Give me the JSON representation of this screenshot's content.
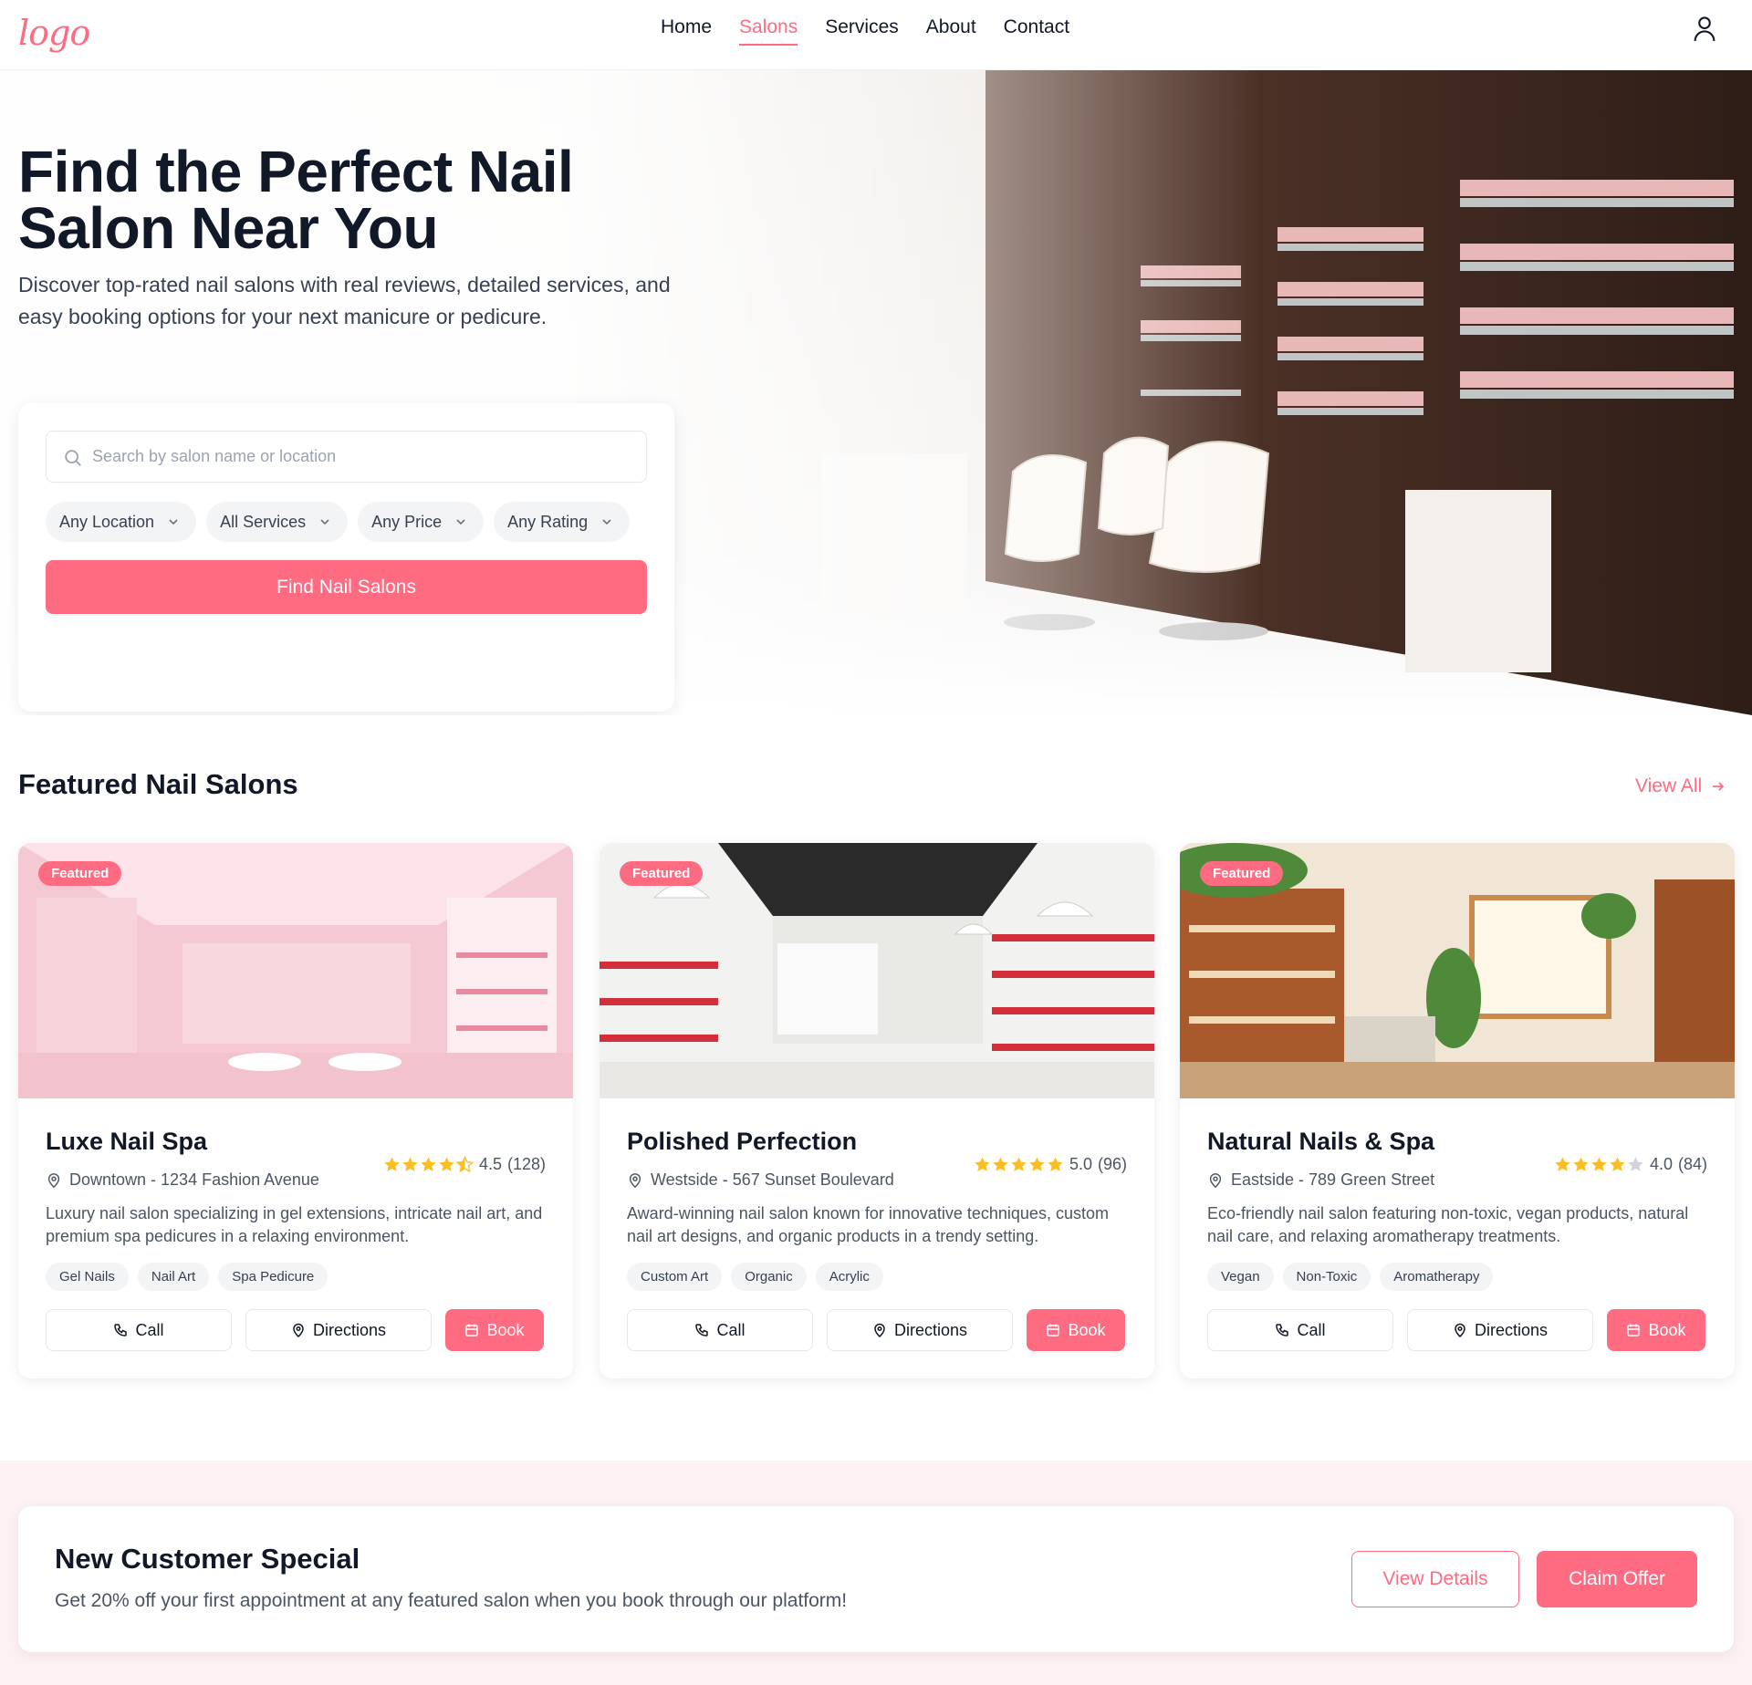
{
  "header": {
    "logo_text": "logo",
    "nav": [
      {
        "label": "Home",
        "active": false
      },
      {
        "label": "Salons",
        "active": true
      },
      {
        "label": "Services",
        "active": false
      },
      {
        "label": "About",
        "active": false
      },
      {
        "label": "Contact",
        "active": false
      }
    ],
    "account_icon": "user-icon"
  },
  "hero": {
    "title_line1": "Find the Perfect Nail",
    "title_line2": "Salon Near You",
    "subtitle": "Discover top-rated nail salons with real reviews, detailed services, and easy booking options for your next manicure or pedicure.",
    "search": {
      "placeholder": "Search by salon name or location",
      "value": ""
    },
    "filters": [
      "Any Location",
      "All Services",
      "Any Price",
      "Any Rating"
    ],
    "cta": "Find Nail Salons"
  },
  "featured": {
    "title": "Featured Nail Salons",
    "view_all": "View All",
    "salons": [
      {
        "badge": "Featured",
        "name": "Luxe Nail Spa",
        "rating": 4.5,
        "rating_text": "4.5",
        "reviews": "(128)",
        "location": "Downtown - 1234 Fashion Avenue",
        "description": "Luxury nail salon specializing in gel extensions, intricate nail art, and premium spa pedicures in a relaxing environment.",
        "tags": [
          "Gel Nails",
          "Nail Art",
          "Spa Pedicure"
        ],
        "call": "Call",
        "directions": "Directions",
        "book": "Book"
      },
      {
        "badge": "Featured",
        "name": "Polished Perfection",
        "rating": 5.0,
        "rating_text": "5.0",
        "reviews": "(96)",
        "location": "Westside - 567 Sunset Boulevard",
        "description": "Award-winning nail salon known for innovative techniques, custom nail art designs, and organic products in a trendy setting.",
        "tags": [
          "Custom Art",
          "Organic",
          "Acrylic"
        ],
        "call": "Call",
        "directions": "Directions",
        "book": "Book"
      },
      {
        "badge": "Featured",
        "name": "Natural Nails & Spa",
        "rating": 4.0,
        "rating_text": "4.0",
        "reviews": "(84)",
        "location": "Eastside - 789 Green Street",
        "description": "Eco-friendly nail salon featuring non-toxic, vegan products, natural nail care, and relaxing aromatherapy treatments.",
        "tags": [
          "Vegan",
          "Non-Toxic",
          "Aromatherapy"
        ],
        "call": "Call",
        "directions": "Directions",
        "book": "Book"
      }
    ]
  },
  "promo": {
    "title": "New Customer Special",
    "text": "Get 20% off your first appointment at any featured salon when you book through our platform!",
    "view_details": "View Details",
    "claim": "Claim Offer"
  },
  "colors": {
    "accent": "#ff6b81",
    "text": "#111827",
    "muted": "#4b5563",
    "star": "#fbbf24",
    "promo_bg": "#fdf1f3"
  }
}
